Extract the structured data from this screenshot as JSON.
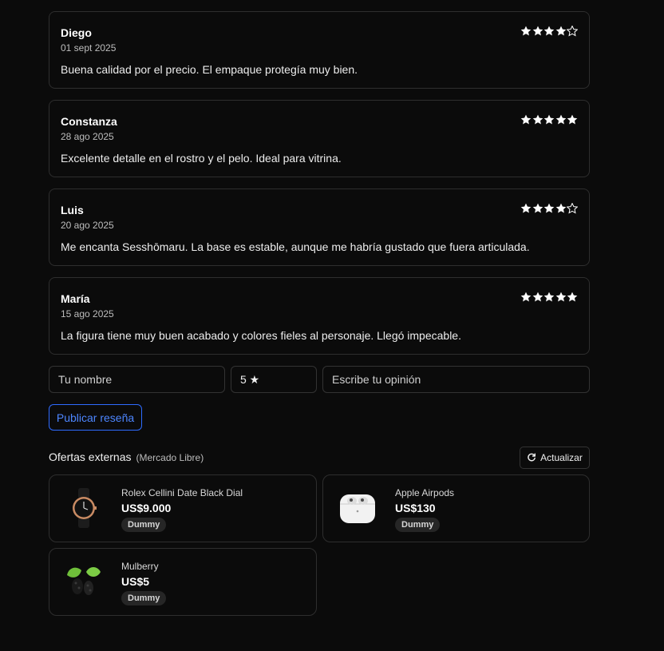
{
  "reviews": [
    {
      "author": "Diego",
      "date": "01 sept 2025",
      "text": "Buena calidad por el precio. El empaque protegía muy bien.",
      "rating": 4
    },
    {
      "author": "Constanza",
      "date": "28 ago 2025",
      "text": "Excelente detalle en el rostro y el pelo. Ideal para vitrina.",
      "rating": 5
    },
    {
      "author": "Luis",
      "date": "20 ago 2025",
      "text": "Me encanta Sesshōmaru. La base es estable, aunque me habría gustado que fuera articulada.",
      "rating": 4
    },
    {
      "author": "María",
      "date": "15 ago 2025",
      "text": "La figura tiene muy buen acabado y colores fieles al personaje. Llegó impecable.",
      "rating": 5
    }
  ],
  "form": {
    "name_placeholder": "Tu nombre",
    "rating_value": "5 ★",
    "opinion_placeholder": "Escribe tu opinión",
    "publish_label": "Publicar reseña"
  },
  "offers": {
    "title": "Ofertas externas",
    "subtitle": "(Mercado Libre)",
    "refresh_label": "Actualizar",
    "items": [
      {
        "name": "Rolex Cellini Date Black Dial",
        "price": "US$9.000",
        "badge": "Dummy",
        "icon": "watch-icon"
      },
      {
        "name": "Apple Airpods",
        "price": "US$130",
        "badge": "Dummy",
        "icon": "airpods-icon"
      },
      {
        "name": "Mulberry",
        "price": "US$5",
        "badge": "Dummy",
        "icon": "mulberry-icon"
      }
    ]
  },
  "colors": {
    "accent": "#2e6bff",
    "background": "#0b0b0b",
    "border": "#2e2e2e"
  }
}
